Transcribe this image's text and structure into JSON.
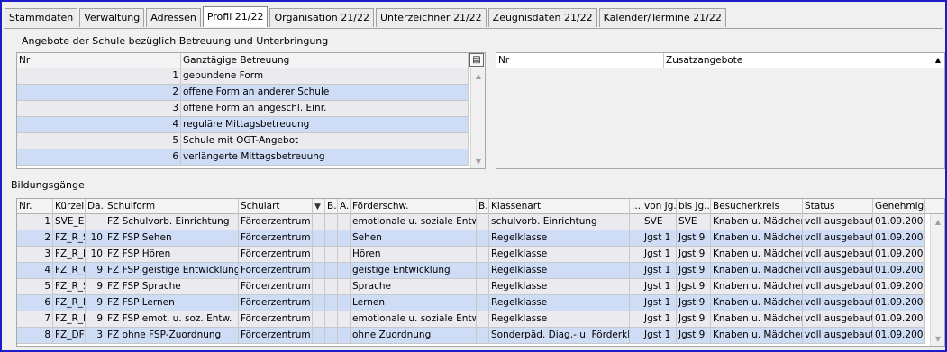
{
  "tabs": [
    {
      "label": "Stammdaten"
    },
    {
      "label": "Verwaltung"
    },
    {
      "label": "Adressen"
    },
    {
      "label": "Profil 21/22",
      "active": true
    },
    {
      "label": "Organisation 21/22"
    },
    {
      "label": "Unterzeichner 21/22"
    },
    {
      "label": "Zeugnisdaten 21/22"
    },
    {
      "label": "Kalender/Termine 21/22"
    }
  ],
  "angebote": {
    "title": "Angebote der Schule bezüglich Betreuung und Unterbringung",
    "betreuung": {
      "headers": [
        "Nr",
        "Ganztägige Betreuung"
      ],
      "rows": [
        [
          "1",
          "gebundene Form"
        ],
        [
          "2",
          "offene Form an anderer Schule"
        ],
        [
          "3",
          "offene Form an angeschl. Einr."
        ],
        [
          "4",
          "reguläre Mittagsbetreuung"
        ],
        [
          "5",
          "Schule mit OGT-Angebot"
        ],
        [
          "6",
          "verlängerte Mittagsbetreuung"
        ]
      ]
    },
    "zusatz": {
      "headers": [
        "Nr",
        "Zusatzangebote"
      ]
    }
  },
  "bildungsgaenge": {
    "title": "Bildungsgänge",
    "headers": [
      "Nr.",
      "Kürzel",
      "Da...",
      "Schulform",
      "Schulart",
      "",
      "B...",
      "A...",
      "Förderschw.",
      "B...",
      "Klassenart",
      "...",
      "von Jg...",
      "bis Jg...",
      "Besucherkreis",
      "Status",
      "Genehmig..."
    ],
    "rows": [
      [
        "1",
        "SVE_ESE",
        "",
        "FZ Schulvorb. Einrichtung",
        "Förderzentrum",
        "",
        "",
        "",
        "emotionale u. soziale Entw.",
        "",
        "schulvorb. Einrichtung",
        "",
        "SVE",
        "SVE",
        "Knaben u. Mädchen",
        "voll ausgebaut",
        "01.09.2000"
      ],
      [
        "2",
        "FZ_R_SE",
        "10",
        "FZ FSP Sehen",
        "Förderzentrum",
        "",
        "",
        "",
        "Sehen",
        "",
        "Regelklasse",
        "",
        "Jgst 1",
        "Jgst 9",
        "Knaben u. Mädchen",
        "voll ausgebaut",
        "01.09.2000"
      ],
      [
        "3",
        "FZ_R_H",
        "10",
        "FZ FSP Hören",
        "Förderzentrum",
        "",
        "",
        "",
        "Hören",
        "",
        "Regelklasse",
        "",
        "Jgst 1",
        "Jgst 9",
        "Knaben u. Mädchen",
        "voll ausgebaut",
        "01.09.2000"
      ],
      [
        "4",
        "FZ_R_GE",
        "9",
        "FZ FSP geistige Entwicklung",
        "Förderzentrum",
        "",
        "",
        "",
        "geistige Entwicklung",
        "",
        "Regelklasse",
        "",
        "Jgst 1",
        "Jgst 9",
        "Knaben u. Mädchen",
        "voll ausgebaut",
        "01.09.2000"
      ],
      [
        "5",
        "FZ_R_SR",
        "9",
        "FZ FSP Sprache",
        "Förderzentrum",
        "",
        "",
        "",
        "Sprache",
        "",
        "Regelklasse",
        "",
        "Jgst 1",
        "Jgst 9",
        "Knaben u. Mädchen",
        "voll ausgebaut",
        "01.09.2000"
      ],
      [
        "6",
        "FZ_R_LE",
        "9",
        "FZ FSP Lernen",
        "Förderzentrum",
        "",
        "",
        "",
        "Lernen",
        "",
        "Regelklasse",
        "",
        "Jgst 1",
        "Jgst 9",
        "Knaben u. Mädchen",
        "voll ausgebaut",
        "01.09.2000"
      ],
      [
        "7",
        "FZ_R_ESE",
        "9",
        "FZ FSP emot. u. soz. Entw.",
        "Förderzentrum",
        "",
        "",
        "",
        "emotionale u. soziale Entw.",
        "",
        "Regelklasse",
        "",
        "Jgst 1",
        "Jgst 9",
        "Knaben u. Mädchen",
        "voll ausgebaut",
        "01.09.2000"
      ],
      [
        "8",
        "FZ_DFK",
        "3",
        "FZ ohne FSP-Zuordnung",
        "Förderzentrum",
        "",
        "",
        "",
        "ohne Zuordnung",
        "",
        "Sonderpäd. Diag.- u. Förderkl.",
        "",
        "Jgst 1",
        "Jgst 9",
        "Knaben u. Mädchen",
        "voll ausgebaut",
        "01.09.2000"
      ]
    ]
  },
  "colors": {
    "frame": "#1c1cc8",
    "row_odd": "#ebebef",
    "row_even": "#cfdcf6"
  },
  "icons": {
    "column_chooser": "column-chooser-icon",
    "filter": "filter-icon",
    "sort_ascending": "sort-ascending-icon"
  }
}
